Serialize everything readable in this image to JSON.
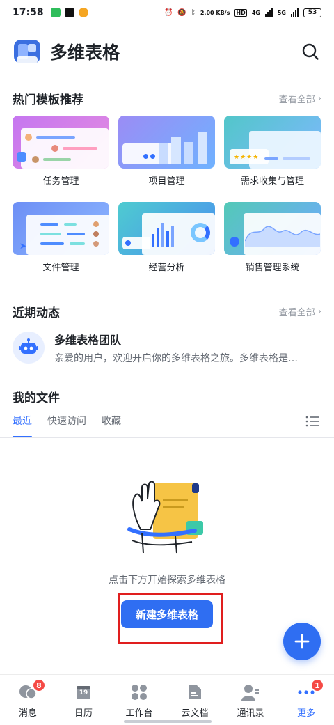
{
  "status_bar": {
    "time": "17:58",
    "net_speed": "2.00 KB/s",
    "hd_label": "HD",
    "signal_1": "4G",
    "signal_2": "5G",
    "battery": "53"
  },
  "header": {
    "title": "多维表格",
    "search_icon": "search-icon"
  },
  "templates": {
    "title": "热门模板推荐",
    "see_all": "查看全部",
    "items": [
      {
        "label": "任务管理"
      },
      {
        "label": "项目管理"
      },
      {
        "label": "需求收集与管理"
      },
      {
        "label": "文件管理"
      },
      {
        "label": "经营分析"
      },
      {
        "label": "销售管理系统"
      }
    ]
  },
  "activity": {
    "title": "近期动态",
    "see_all": "查看全部",
    "item": {
      "name": "多维表格团队",
      "desc": "亲爱的用户，欢迎开启你的多维表格之旅。多维表格是…"
    }
  },
  "files": {
    "title": "我的文件",
    "tabs": [
      "最近",
      "快速访问",
      "收藏"
    ],
    "active_tab": "最近",
    "empty_hint": "点击下方开始探索多维表格",
    "create_button": "新建多维表格"
  },
  "bottom_nav": {
    "items": [
      {
        "label": "消息",
        "icon": "message-icon",
        "badge": "8"
      },
      {
        "label": "日历",
        "icon": "calendar-icon",
        "day": "19"
      },
      {
        "label": "工作台",
        "icon": "workbench-icon"
      },
      {
        "label": "云文档",
        "icon": "cloud-docs-icon"
      },
      {
        "label": "通讯录",
        "icon": "contacts-icon"
      },
      {
        "label": "更多",
        "icon": "more-icon",
        "badge": "1"
      }
    ]
  },
  "colors": {
    "accent": "#3370ff",
    "button": "#2f6ef2",
    "badge": "#f54a45",
    "highlight": "#e01e1e"
  }
}
